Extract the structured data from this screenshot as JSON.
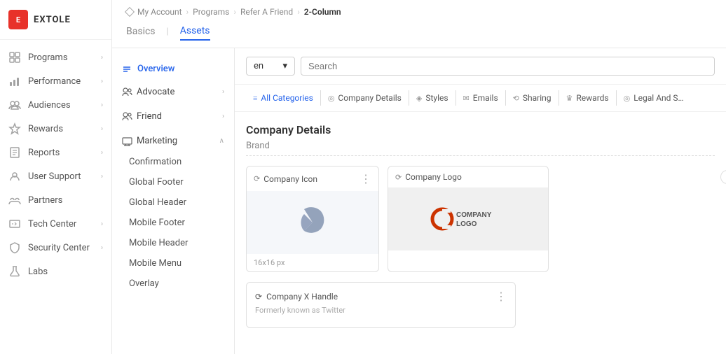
{
  "app": {
    "name": "EXTOLE"
  },
  "sidebar": {
    "collapse_label": "‹",
    "items": [
      {
        "id": "programs",
        "label": "Programs",
        "has_children": true
      },
      {
        "id": "performance",
        "label": "Performance",
        "has_children": true
      },
      {
        "id": "audiences",
        "label": "Audiences",
        "has_children": true
      },
      {
        "id": "rewards",
        "label": "Rewards",
        "has_children": true
      },
      {
        "id": "reports",
        "label": "Reports",
        "has_children": true
      },
      {
        "id": "user-support",
        "label": "User Support",
        "has_children": true
      },
      {
        "id": "partners",
        "label": "Partners",
        "has_children": false
      },
      {
        "id": "tech-center",
        "label": "Tech Center",
        "has_children": true
      },
      {
        "id": "security-center",
        "label": "Security Center",
        "has_children": true
      },
      {
        "id": "labs",
        "label": "Labs",
        "has_children": false
      }
    ]
  },
  "breadcrumb": {
    "items": [
      "My Account",
      "Programs",
      "Refer A Friend",
      "2-Column"
    ]
  },
  "header_tabs": [
    {
      "id": "basics",
      "label": "Basics",
      "active": false
    },
    {
      "id": "assets",
      "label": "Assets",
      "active": true
    }
  ],
  "left_panel": {
    "overview_label": "Overview",
    "sections": [
      {
        "id": "advocate",
        "label": "Advocate",
        "expanded": false
      },
      {
        "id": "friend",
        "label": "Friend",
        "expanded": false
      },
      {
        "id": "marketing",
        "label": "Marketing",
        "expanded": true
      }
    ],
    "marketing_items": [
      "Confirmation",
      "Global Footer",
      "Global Header",
      "Mobile Footer",
      "Mobile Header",
      "Mobile Menu",
      "Overlay"
    ]
  },
  "filter": {
    "lang": "en",
    "lang_chevron": "▾",
    "search_placeholder": "Search"
  },
  "categories": [
    {
      "id": "all",
      "label": "All Categories",
      "active": true,
      "icon": "≡"
    },
    {
      "id": "company-details",
      "label": "Company Details",
      "active": false,
      "icon": "◎"
    },
    {
      "id": "styles",
      "label": "Styles",
      "active": false,
      "icon": "◈"
    },
    {
      "id": "emails",
      "label": "Emails",
      "active": false,
      "icon": "✉"
    },
    {
      "id": "sharing",
      "label": "Sharing",
      "active": false,
      "icon": "⟲"
    },
    {
      "id": "rewards",
      "label": "Rewards",
      "active": false,
      "icon": "♛"
    },
    {
      "id": "legal",
      "label": "Legal And S…",
      "active": false,
      "icon": "◎"
    }
  ],
  "section": {
    "title": "Company Details",
    "sub_label": "Brand"
  },
  "cards": [
    {
      "id": "company-icon",
      "title": "Company Icon",
      "subtitle": "16x16 px",
      "has_menu": true
    },
    {
      "id": "company-logo",
      "title": "Company Logo",
      "subtitle": "",
      "has_menu": false
    }
  ],
  "handle": {
    "title": "Company X Handle",
    "subtitle": "Formerly known as Twitter"
  }
}
